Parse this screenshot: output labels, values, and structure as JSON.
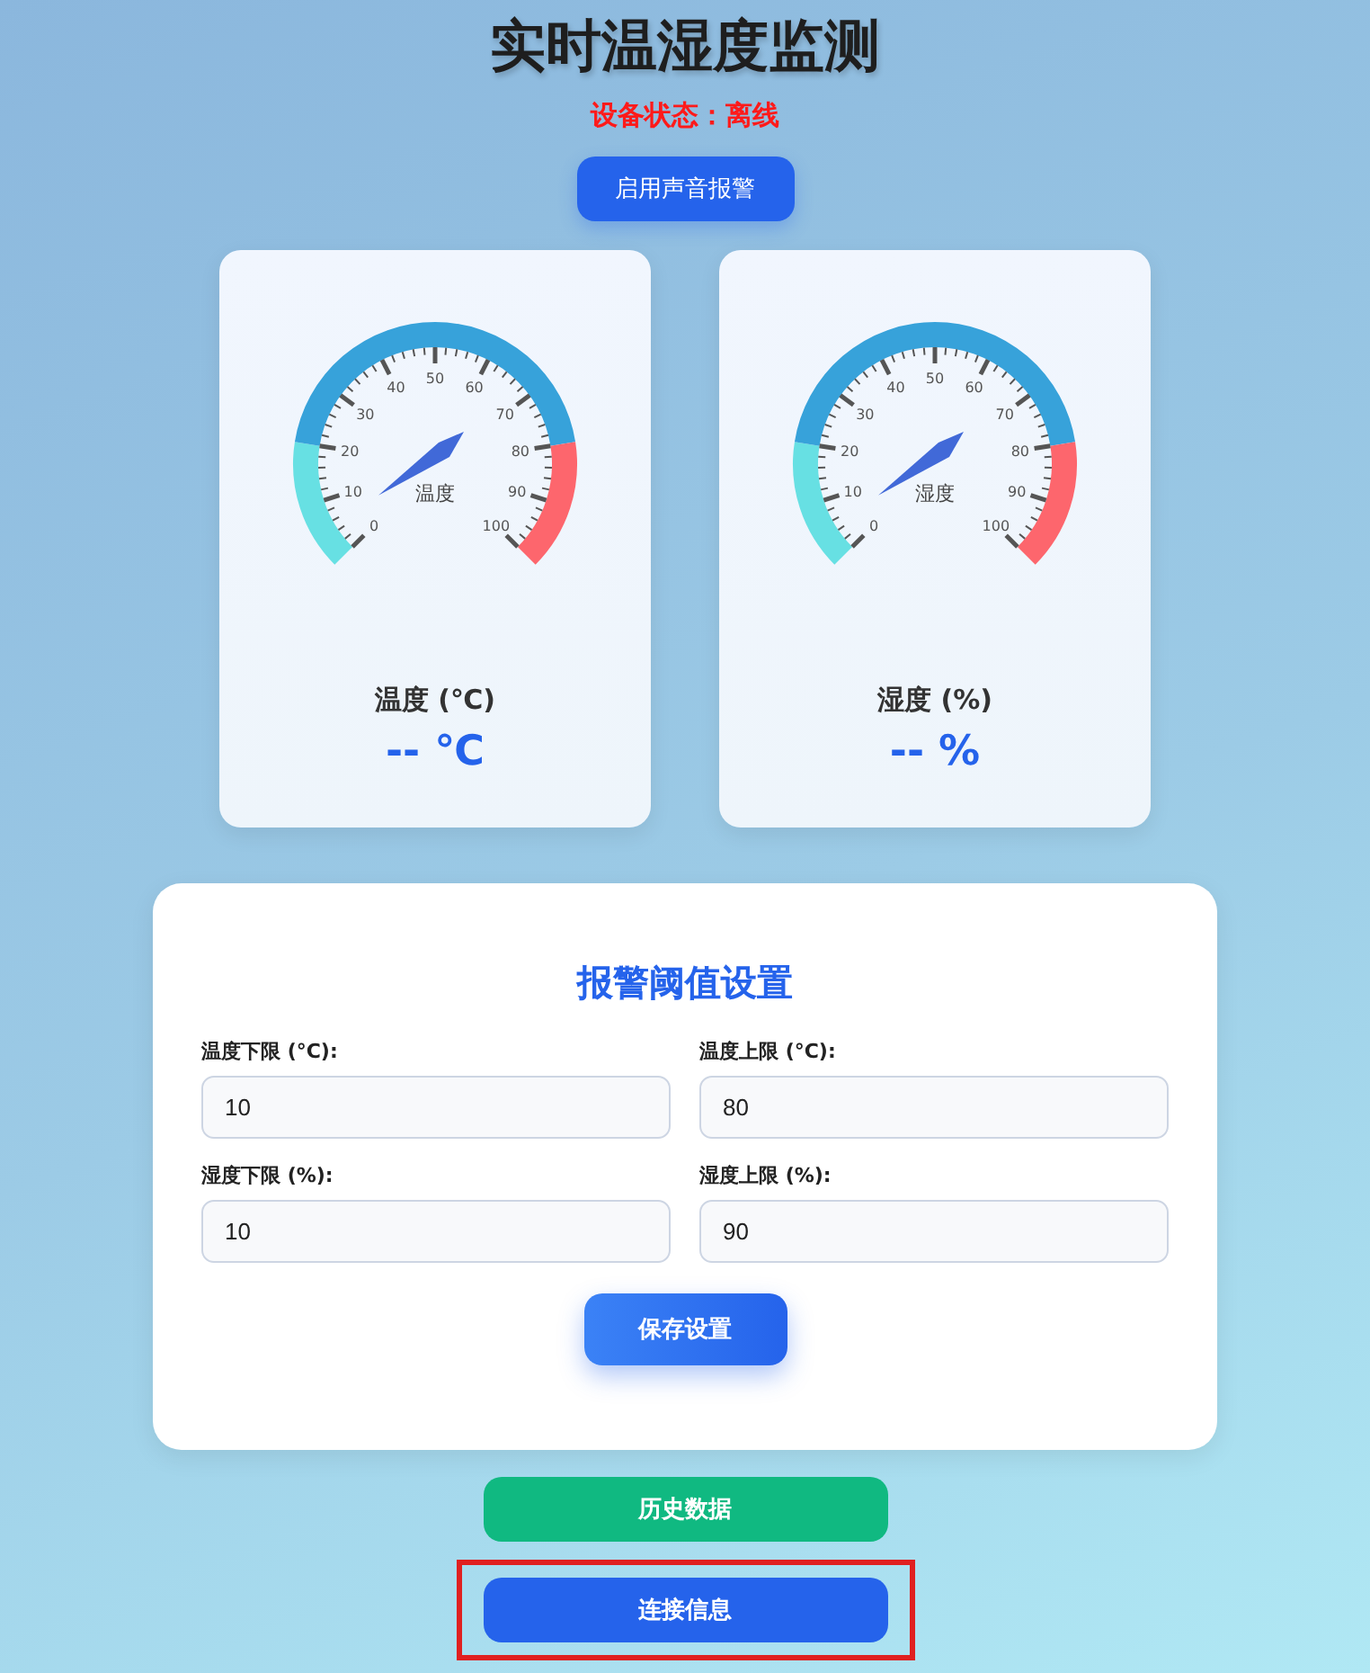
{
  "title": "实时温湿度监测",
  "status": {
    "label": "设备状态：",
    "value": "离线",
    "online": false
  },
  "alarm_button": {
    "label": "启用声音报警"
  },
  "gauges": [
    {
      "name": "温度",
      "caption": "温度 (℃)",
      "reading": "-- ℃",
      "scale_labels": [
        "0",
        "10",
        "20",
        "30",
        "40",
        "50",
        "60",
        "70",
        "80",
        "90",
        "100"
      ]
    },
    {
      "name": "湿度",
      "caption": "湿度 (%)",
      "reading": "-- %",
      "scale_labels": [
        "0",
        "10",
        "20",
        "30",
        "40",
        "50",
        "60",
        "70",
        "80",
        "90",
        "100"
      ]
    }
  ],
  "threshold_panel": {
    "title": "报警阈值设置",
    "fields": [
      {
        "label": "温度下限 (°C):",
        "value": "10"
      },
      {
        "label": "温度上限 (°C):",
        "value": "80"
      },
      {
        "label": "湿度下限 (%):",
        "value": "10"
      },
      {
        "label": "湿度上限 (%):",
        "value": "90"
      }
    ],
    "save_button": "保存设置"
  },
  "bottom_buttons": [
    {
      "kind": "history",
      "label": "历史数据",
      "highlighted": false
    },
    {
      "kind": "connection",
      "label": "连接信息",
      "highlighted": true
    }
  ]
}
